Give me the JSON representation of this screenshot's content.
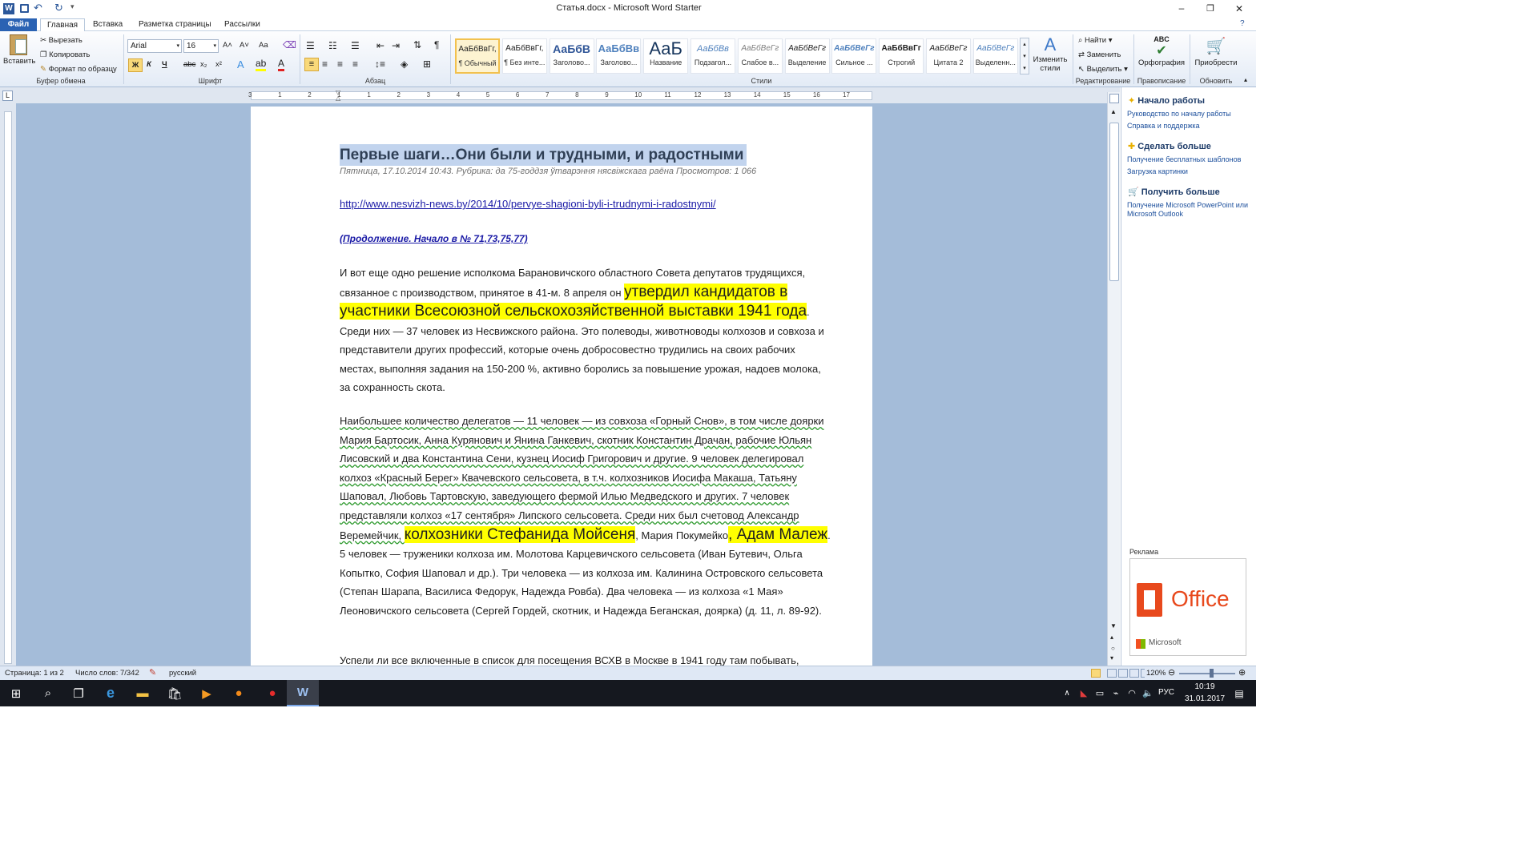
{
  "window": {
    "title": "Статья.docx - Microsoft Word Starter"
  },
  "tabs": {
    "file": "Файл",
    "items": [
      "Главная",
      "Вставка",
      "Разметка страницы",
      "Рассылки"
    ]
  },
  "clipboard": {
    "paste": "Вставить",
    "cut": "Вырезать",
    "copy": "Копировать",
    "format_painter": "Формат по образцу",
    "label": "Буфер обмена"
  },
  "font": {
    "name": "Arial",
    "size": "16",
    "label": "Шрифт",
    "bold": "Ж",
    "italic": "К",
    "underline": "Ч",
    "strike": "abc",
    "sub": "x₂",
    "sup": "x²",
    "grow": "A˄",
    "shrink": "A˅",
    "case": "Aa"
  },
  "paragraph": {
    "label": "Абзац"
  },
  "styles": {
    "label": "Стили",
    "items": [
      {
        "sample": "АаБбВвГг,",
        "name": "¶ Обычный"
      },
      {
        "sample": "АаБбВвГг,",
        "name": "¶ Без инте..."
      },
      {
        "sample": "АаБбВ",
        "name": "Заголово..."
      },
      {
        "sample": "АаБбВв",
        "name": "Заголово..."
      },
      {
        "sample": "АаБ",
        "name": "Название"
      },
      {
        "sample": "АаБбВв",
        "name": "Подзагол..."
      },
      {
        "sample": "АаБбВеГг",
        "name": "Слабое в..."
      },
      {
        "sample": "АаБбВеГг",
        "name": "Выделение"
      },
      {
        "sample": "АаБбВеГг",
        "name": "Сильное ..."
      },
      {
        "sample": "АаБбВвГг",
        "name": "Строгий"
      },
      {
        "sample": "АаБбВеГг",
        "name": "Цитата 2"
      },
      {
        "sample": "АаБбВеГг",
        "name": "Выделенн..."
      }
    ],
    "change": "Изменить стили"
  },
  "editing": {
    "find": "Найти",
    "replace": "Заменить",
    "select": "Выделить",
    "label": "Редактирование"
  },
  "proofing": {
    "spelling": "Орфография",
    "label": "Правописание"
  },
  "upgrade": {
    "button": "Приобрести",
    "label": "Обновить"
  },
  "document": {
    "heading": "Первые шаги…Они были и трудными, и радостными",
    "meta": "Пятница, 17.10.2014 10:43. Рубрика: да 75-годдзя ўтварэння нясвіжскага раёна    Просмотров: 1 066",
    "link": "http://www.nesvizh-news.by/2014/10/pervye-shagioni-byli-i-trudnymi-i-radostnymi/",
    "continuation": "(Продолжение. Начало в  № 71,73,75,77)",
    "p1_a": "И вот еще одно решение исполкома Барановичского  областного Совета  депутатов трудящихся, связанное с производством, принятое в 41-м. 8 апреля  он ",
    "p1_hl": "утвердил кандидатов в участники Всесоюзной  сельскохозяйственной выставки 1941 года",
    "p1_b": ". Среди них — 37 человек из Несвижского района. Это полеводы, животноводы колхозов и совхоза и представители  других профессий, которые очень  добросовестно трудились на своих рабочих местах, выполняя задания на 150-200 %, активно боролись за повышение урожая, надоев молока, за сохранность скота.",
    "p2_a": "Наибольшее количество делегатов — 11 человек — из совхоза «Горный Снов», в том числе  доярки Мария Бартосик, Анна Курянович и Янина Ганкевич, скотник Константин Драчан, рабочие  Юльян Лисовский и два Константина Сени, кузнец Иосиф Григорович и другие. 9 человек делегировал колхоз  «Красный Берег» Квачевского сельсовета, в т.ч.  колхозников Иосифа Макаша, Татьяну   Шаповал, Любовь Тартовскую, заведующего  фермой Илью Медведского и других. 7 человек  представляли колхоз «17 сентября» Липского сельсовета. Среди них был  счетовод Александр Веремейчик, ",
    "p2_hl1": "колхозники   Стефанида   Мойсеня",
    "p2_b": ", Мария Покумейко",
    "p2_hl2": ", Адам Малеж",
    "p2_c": ". 5 человек — труженики  колхоза им. Молотова Карцевичского сельсовета (Иван Бутевич, Ольга  Копытко, София Шаповал и др.).  Три человека — из колхоза  им. Калинина Островского сельсовета (Степан Шарапа, Василиса Федорук, Надежда Ровба). Два человека — из колхоза  «1 Мая» Леоновичского сельсовета (Сергей Гордей, скотник, и Надежда Беганская, доярка) (д.  11, л. 89-92).",
    "p3": "Успели ли все включенные в список для посещения ВСХВ в Москве в 1941 году там побывать,"
  },
  "ruler": {
    "ticks": [
      "3",
      "1",
      "2",
      "1",
      "1",
      "2",
      "3",
      "4",
      "5",
      "6",
      "7",
      "8",
      "9",
      "10",
      "11",
      "12",
      "13",
      "14",
      "15",
      "16",
      "17"
    ]
  },
  "taskpane": {
    "s1_title": "Начало работы",
    "s1_links": [
      "Руководство по началу работы",
      "Справка и поддержка"
    ],
    "s2_title": "Сделать больше",
    "s2_links": [
      "Получение бесплатных шаблонов",
      "Загрузка картинки"
    ],
    "s3_title": "Получить больше",
    "s3_links": [
      "Получение Microsoft PowerPoint или Microsoft Outlook"
    ],
    "ad_label": "Реклама",
    "ad_office": "Office",
    "ad_ms": "Microsoft"
  },
  "status": {
    "page": "Страница: 1 из 2",
    "words": "Число слов: 7/342",
    "lang": "русский",
    "zoom": "120%"
  },
  "taskbar": {
    "lang": "РУС",
    "time": "10:19",
    "date": "31.01.2017"
  },
  "colors": {
    "accent": "#2b579a",
    "highlight": "#ffff00",
    "file_tab": "#2a62b3"
  }
}
